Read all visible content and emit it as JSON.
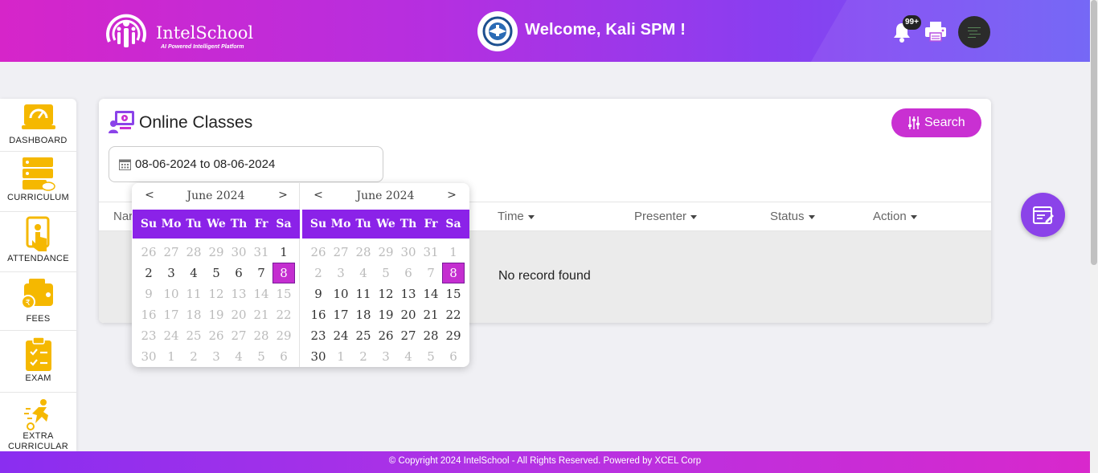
{
  "header": {
    "brand": "IntelSchool",
    "tagline": "AI Powered Intelligent Platform",
    "welcome": "Welcome, Kali SPM !",
    "notification_count": "99+"
  },
  "sidebar": {
    "items": [
      {
        "label": "DASHBOARD",
        "icon": "dashboard-icon"
      },
      {
        "label": "CURRICULUM",
        "icon": "curriculum-icon"
      },
      {
        "label": "ATTENDANCE",
        "icon": "attendance-icon"
      },
      {
        "label": "FEES",
        "icon": "fees-icon"
      },
      {
        "label": "EXAM",
        "icon": "exam-icon"
      },
      {
        "label": "EXTRA CURRICULAR",
        "icon": "extra-curricular-icon"
      }
    ]
  },
  "main": {
    "title": "Online Classes",
    "search_label": "Search",
    "date_range_value": "08-06-2024 to 08-06-2024",
    "columns": [
      "Nar",
      "Time",
      "Presenter",
      "Status",
      "Action"
    ],
    "empty_message": "No record found"
  },
  "datepicker": {
    "weekdays": [
      "Su",
      "Mo",
      "Tu",
      "We",
      "Th",
      "Fr",
      "Sa"
    ],
    "prev": "<",
    "next": ">",
    "calendars": [
      {
        "month_label": "June 2024",
        "selected": "8",
        "weeks": [
          [
            "26",
            "27",
            "28",
            "29",
            "30",
            "31",
            "1"
          ],
          [
            "2",
            "3",
            "4",
            "5",
            "6",
            "7",
            "8"
          ],
          [
            "9",
            "10",
            "11",
            "12",
            "13",
            "14",
            "15"
          ],
          [
            "16",
            "17",
            "18",
            "19",
            "20",
            "21",
            "22"
          ],
          [
            "23",
            "24",
            "25",
            "26",
            "27",
            "28",
            "29"
          ],
          [
            "30",
            "1",
            "2",
            "3",
            "4",
            "5",
            "6"
          ]
        ]
      },
      {
        "month_label": "June 2024",
        "selected": "8",
        "weeks": [
          [
            "26",
            "27",
            "28",
            "29",
            "30",
            "31",
            "1"
          ],
          [
            "2",
            "3",
            "4",
            "5",
            "6",
            "7",
            "8"
          ],
          [
            "9",
            "10",
            "11",
            "12",
            "13",
            "14",
            "15"
          ],
          [
            "16",
            "17",
            "18",
            "19",
            "20",
            "21",
            "22"
          ],
          [
            "23",
            "24",
            "25",
            "26",
            "27",
            "28",
            "29"
          ],
          [
            "30",
            "1",
            "2",
            "3",
            "4",
            "5",
            "6"
          ]
        ]
      }
    ]
  },
  "footer": {
    "text": "© Copyright 2024 IntelSchool - All Rights Reserved. Powered by XCEL Corp"
  },
  "colors": {
    "primary_purple": "#8b22e8",
    "accent_magenta": "#c930d2",
    "icon_yellow": "#f5b800"
  }
}
